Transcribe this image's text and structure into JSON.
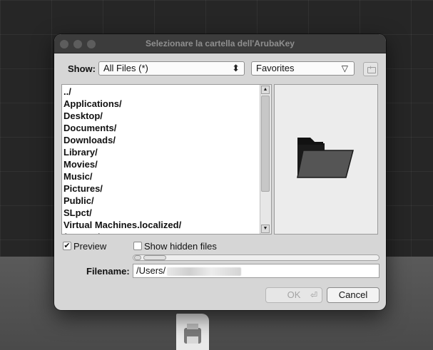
{
  "dialog": {
    "title": "Selezionare la cartella dell'ArubaKey"
  },
  "toolbar": {
    "show_label": "Show:",
    "filter_value": "All Files (*)",
    "location_value": "Favorites"
  },
  "file_list": {
    "items": [
      "../",
      "Applications/",
      "Desktop/",
      "Documents/",
      "Downloads/",
      "Library/",
      "Movies/",
      "Music/",
      "Pictures/",
      "Public/",
      "SLpct/",
      "Virtual Machines.localized/",
      "for mac/"
    ]
  },
  "options": {
    "preview_label": "Preview",
    "preview_checked": true,
    "preview_mark": "✔",
    "hidden_label": "Show hidden files",
    "hidden_checked": false
  },
  "filename": {
    "label": "Filename:",
    "value": "/Users/"
  },
  "buttons": {
    "ok_label": "OK",
    "cancel_label": "Cancel"
  },
  "icons": {
    "preview": "folder-icon",
    "new_folder": "new-folder-icon",
    "desktop_file": "printer-file-icon"
  },
  "colors": {
    "dialog_bg": "#d6d6d6",
    "titlebar": "#3c3c3c",
    "folder_fill": "#1a1a1a",
    "folder_front": "#555555"
  }
}
